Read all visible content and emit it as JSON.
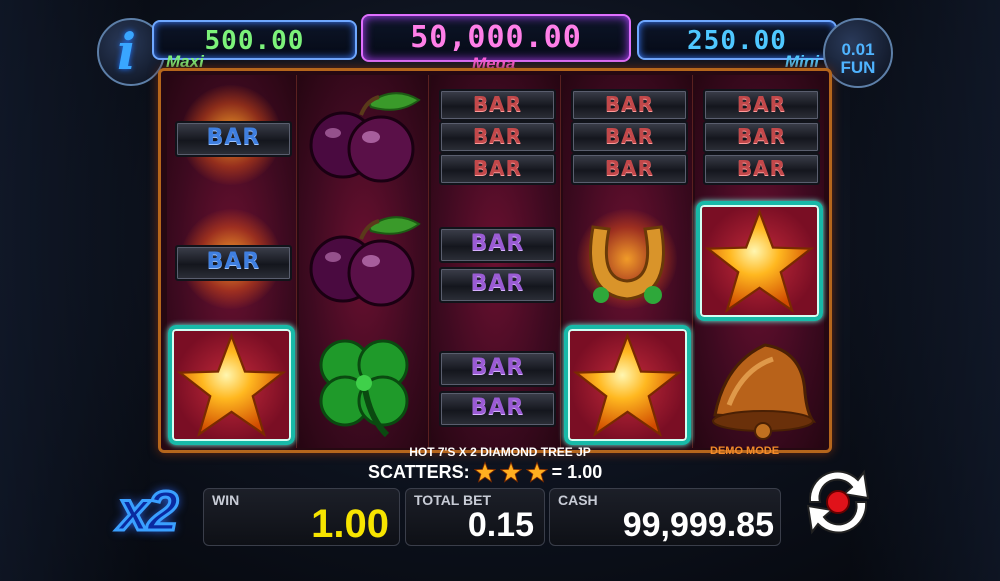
{
  "jackpots": {
    "maxi": {
      "value": "500.00",
      "label": "Maxi"
    },
    "mega": {
      "value": "50,000.00",
      "label": "Mega"
    },
    "mini": {
      "value": "250.00",
      "label": "Mini"
    }
  },
  "info_icon_glyph": "i",
  "denomination": {
    "value": "0.01",
    "currency": "FUN"
  },
  "reels": [
    [
      "bar-single-blue",
      "bar-single-blue",
      "star-scatter-win"
    ],
    [
      "plum",
      "plum",
      "four-leaf-clover"
    ],
    [
      "bar-triple-red",
      "bar-double-purple",
      "bar-double-purple"
    ],
    [
      "bar-triple-red",
      "horseshoe",
      "star-scatter-win"
    ],
    [
      "bar-triple-red",
      "star-scatter-win",
      "bell"
    ]
  ],
  "bar_text": "BAR",
  "game_name": "HOT 7'S X 2 DIAMOND TREE JP",
  "demo_mode_label": "DEMO MODE",
  "scatters": {
    "label": "SCATTERS:",
    "star_count": 3,
    "result": "= 1.00"
  },
  "multiplier": "x2",
  "panels": {
    "win": {
      "label": "WIN",
      "value": "1.00"
    },
    "total_bet": {
      "label": "TOTAL BET",
      "value": "0.15"
    },
    "cash": {
      "label": "CASH",
      "value": "99,999.85"
    }
  },
  "colors": {
    "win_value": "#f6e400",
    "maxi": "#7cf27a",
    "mega": "#ff5fe0",
    "mini": "#4fc8ff",
    "win_highlight": "#18b9a8"
  },
  "icons": [
    "info-icon",
    "spin-icon",
    "star-icon",
    "plum-icon",
    "clover-icon",
    "horseshoe-icon",
    "bell-icon"
  ]
}
